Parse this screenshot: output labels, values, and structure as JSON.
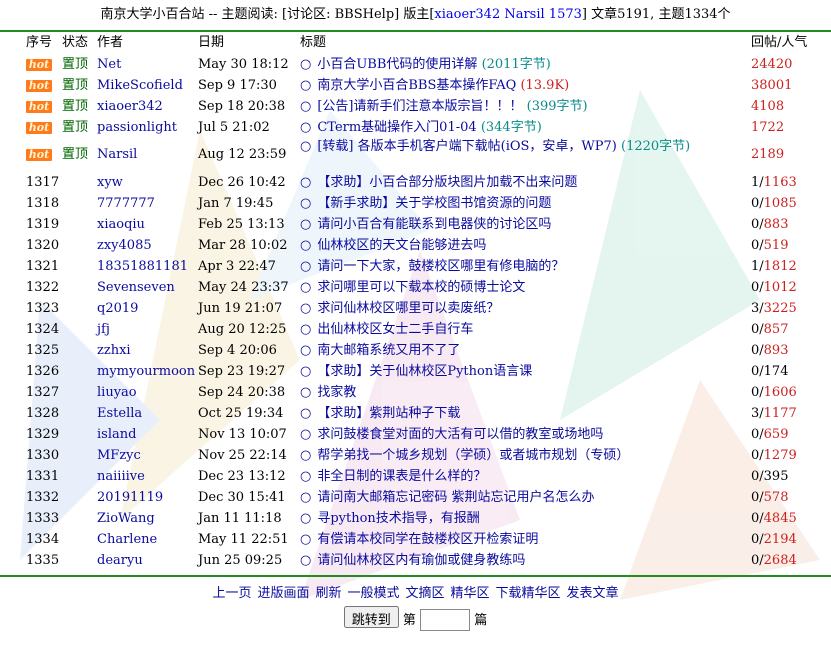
{
  "header": {
    "prefix": "南京大学小百合站 -- 主题阅读: [讨论区: BBSHelp] 版主[",
    "moderators": "xiaoer342 Narsil 1573",
    "suffix": "] 文章5191, 主题1334个"
  },
  "columns": {
    "no": "序号",
    "status": "状态",
    "author": "作者",
    "date": "日期",
    "title": "标题",
    "replies": "回帖/人气"
  },
  "pinned": [
    {
      "badge": "hot",
      "status": "置顶",
      "author": "Net",
      "date": "May 30 18:12",
      "title": "小百合UBB代码的使用详解",
      "extra": "(2011字节)",
      "extra_style": "dim",
      "views": "24420"
    },
    {
      "badge": "hot",
      "status": "置顶",
      "author": "MikeScofield",
      "date": "Sep 9 17:30",
      "title": "南京大学小百合BBS基本操作FAQ",
      "extra": "(13.9K)",
      "extra_style": "dimred",
      "views": "38001"
    },
    {
      "badge": "hot",
      "status": "置顶",
      "author": "xiaoer342",
      "date": "Sep 18 20:38",
      "title": "[公告]请新手们注意本版宗旨！！！",
      "extra": "(399字节)",
      "extra_style": "dim",
      "views": "4108"
    },
    {
      "badge": "hot",
      "status": "置顶",
      "author": "passionlight",
      "date": "Jul 5 21:02",
      "title": "CTerm基础操作入门01-04",
      "extra": "(344字节)",
      "extra_style": "dim",
      "views": "1722"
    },
    {
      "badge": "hot",
      "status": "置顶",
      "author": "Narsil",
      "date": "Aug 12 23:59",
      "title": "[转载] 各版本手机客户端下载帖(iOS，安卓，WP7)",
      "extra": "(1220字节)",
      "extra_style": "dim",
      "views": "2189"
    }
  ],
  "rows": [
    {
      "no": "1317",
      "author": "xyw",
      "date": "Dec 26 10:42",
      "title": "【求助】小百合部分版块图片加载不出来问题",
      "replies": "1/",
      "views": "1163"
    },
    {
      "no": "1318",
      "author": "7777777",
      "date": "Jan 7 19:45",
      "title": "【新手求助】关于学校图书馆资源的问题",
      "replies": "0/",
      "views": "1085"
    },
    {
      "no": "1319",
      "author": "xiaoqiu",
      "date": "Feb 25 13:13",
      "title": "请问小百合有能联系到电器侠的讨论区吗",
      "replies": "0/",
      "views": "883"
    },
    {
      "no": "1320",
      "author": "zxy4085",
      "date": "Mar 28 10:02",
      "title": "仙林校区的天文台能够进去吗",
      "replies": "0/",
      "views": "519"
    },
    {
      "no": "1321",
      "author": "18351881181",
      "date": "Apr 3 22:47",
      "title": "请问一下大家，鼓楼校区哪里有修电脑的？",
      "replies": "1/",
      "views": "1812"
    },
    {
      "no": "1322",
      "author": "Sevenseven",
      "date": "May 24 23:37",
      "title": "求问哪里可以下载本校的硕博士论文",
      "replies": "0/",
      "views": "1012"
    },
    {
      "no": "1323",
      "author": "q2019",
      "date": "Jun 19 21:07",
      "title": "求问仙林校区哪里可以卖废纸？",
      "replies": "3/",
      "views": "3225"
    },
    {
      "no": "1324",
      "author": "jfj",
      "date": "Aug 20 12:25",
      "title": "出仙林校区女士二手自行车",
      "replies": "0/",
      "views": "857"
    },
    {
      "no": "1325",
      "author": "zzhxi",
      "date": "Sep 4 20:06",
      "title": "南大邮箱系统又用不了了",
      "replies": "0/",
      "views": "893"
    },
    {
      "no": "1326",
      "author": "mymyourmoon",
      "date": "Sep 23 19:27",
      "title": "【求助】关于仙林校区Python语言课",
      "replies": "0/",
      "views": "174",
      "plain": true
    },
    {
      "no": "1327",
      "author": "liuyao",
      "date": "Sep 24 20:38",
      "title": "找家教",
      "replies": "0/",
      "views": "1606"
    },
    {
      "no": "1328",
      "author": "Estella",
      "date": "Oct 25 19:34",
      "title": "【求助】紫荆站种子下载",
      "replies": "3/",
      "views": "1177"
    },
    {
      "no": "1329",
      "author": "island",
      "date": "Nov 13 10:07",
      "title": "求问鼓楼食堂对面的大活有可以借的教室或场地吗",
      "replies": "0/",
      "views": "659"
    },
    {
      "no": "1330",
      "author": "MFzyc",
      "date": "Nov 25 22:14",
      "title": "帮学弟找一个城乡规划（学硕）或者城市规划（专硕）",
      "replies": "0/",
      "views": "1279"
    },
    {
      "no": "1331",
      "author": "naiiiive",
      "date": "Dec 23 13:12",
      "title": "非全日制的课表是什么样的？",
      "replies": "0/",
      "views": "395",
      "plain": true
    },
    {
      "no": "1332",
      "author": "20191119",
      "date": "Dec 30 15:41",
      "title": "请问南大邮箱忘记密码 紫荆站忘记用户名怎么办",
      "replies": "0/",
      "views": "578"
    },
    {
      "no": "1333",
      "author": "ZioWang",
      "date": "Jan 11 11:18",
      "title": "寻python技术指导，有报酬",
      "replies": "0/",
      "views": "4845"
    },
    {
      "no": "1334",
      "author": "Charlene",
      "date": "May 11 22:51",
      "title": "有偿请本校同学在鼓楼校区开检索证明",
      "replies": "0/",
      "views": "2194"
    },
    {
      "no": "1335",
      "author": "dearyu",
      "date": "Jun 25 09:25",
      "title": "请问仙林校区内有瑜伽或健身教练吗",
      "replies": "0/",
      "views": "2684"
    }
  ],
  "footer": {
    "links": [
      "上一页",
      "进版画面",
      "刷新",
      "一般模式",
      "文摘区",
      "精华区",
      "下载精华区",
      "发表文章"
    ],
    "jump_button": "跳转到",
    "jump_prefix": "第",
    "jump_suffix": "篇",
    "jump_value": ""
  },
  "colors": {
    "rule": "#228b22",
    "link": "#0a0a9e",
    "hot_badge": "#ff7a1a",
    "pin": "#006400",
    "views_red": "#cc2020"
  },
  "icons": {
    "hot": "hot-badge-icon",
    "circle": "circle-icon"
  }
}
